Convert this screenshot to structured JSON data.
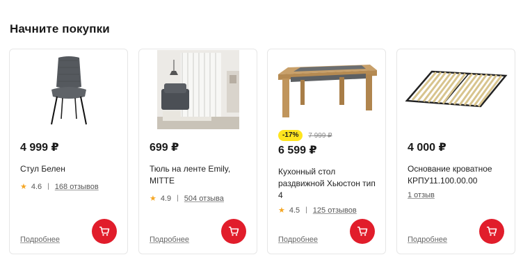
{
  "section": {
    "title": "Начните покупки"
  },
  "colors": {
    "accent": "#e11d2b",
    "badge": "#ffe51f",
    "star": "#f5a623"
  },
  "products": [
    {
      "price": "4 999 ₽",
      "name": "Стул Белен",
      "rating": "4.6",
      "reviews": "168 отзывов",
      "more": "Подробнее",
      "image": "grey-chair-image"
    },
    {
      "price": "699 ₽",
      "name": "Тюль на ленте Emily, MITTE",
      "rating": "4.9",
      "reviews": "504 отзыва",
      "more": "Подробнее",
      "image": "curtain-room-image"
    },
    {
      "discount": "-17%",
      "old_price": "7 999 ₽",
      "price": "6 599 ₽",
      "name": "Кухонный стол раздвижной Хьюстон тип 4",
      "rating": "4.5",
      "reviews": "125 отзывов",
      "more": "Подробнее",
      "image": "kitchen-table-image"
    },
    {
      "price": "4 000 ₽",
      "name": "Основание кроватное КРПУ11.100.00.00",
      "reviews": "1 отзыв",
      "more": "Подробнее",
      "image": "bed-base-image"
    }
  ]
}
